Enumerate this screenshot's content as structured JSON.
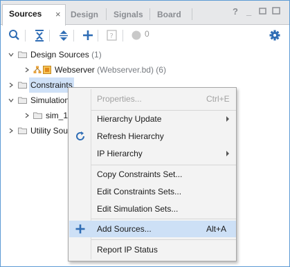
{
  "tabs": [
    {
      "label": "Sources",
      "active": true
    },
    {
      "label": "Design"
    },
    {
      "label": "Signals"
    },
    {
      "label": "Board"
    }
  ],
  "tab_close": "×",
  "window_controls": {
    "help": "?",
    "minimize": "_",
    "restore": "☐",
    "maximize": "☐"
  },
  "toolbar": {
    "icons": [
      "search-icon",
      "collapse-all-icon",
      "expand-all-icon",
      "add-icon",
      "properties-icon",
      "status-dot-icon",
      "gear-icon"
    ],
    "count": "0"
  },
  "tree": {
    "design_sources": {
      "label": "Design Sources",
      "count": "(1)"
    },
    "webserver": {
      "label": "Webserver",
      "detail": "(Webserver.bd) (6)"
    },
    "constraints": {
      "label": "Constraints"
    },
    "simulation": {
      "label": "Simulation"
    },
    "sim_1": {
      "label": "sim_1"
    },
    "utility": {
      "label": "Utility Sou"
    }
  },
  "context_menu": {
    "properties": {
      "label": "Properties...",
      "shortcut": "Ctrl+E",
      "enabled": false
    },
    "hierarchy_update": {
      "label": "Hierarchy Update"
    },
    "refresh_hierarchy": {
      "label": "Refresh Hierarchy"
    },
    "ip_hierarchy": {
      "label": "IP Hierarchy"
    },
    "copy_constraints": {
      "label": "Copy Constraints Set..."
    },
    "edit_constraints": {
      "label": "Edit Constraints Sets..."
    },
    "edit_simulation": {
      "label": "Edit Simulation Sets..."
    },
    "add_sources": {
      "label": "Add Sources...",
      "shortcut": "Alt+A",
      "highlighted": true
    },
    "report_ip_status": {
      "label": "Report IP Status"
    }
  },
  "colors": {
    "accent": "#2f6db5",
    "selection": "#cfe1f7",
    "menu_highlight": "#cde0f6"
  }
}
